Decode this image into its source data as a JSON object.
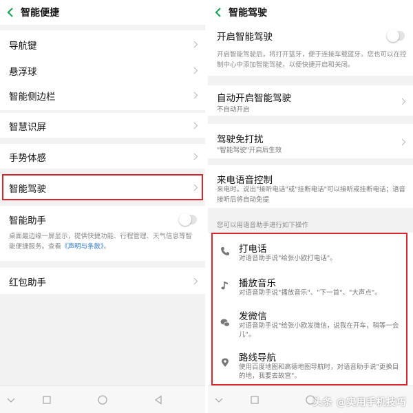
{
  "left": {
    "title": "智能便捷",
    "items": [
      {
        "label": "导航键"
      },
      {
        "label": "悬浮球"
      },
      {
        "label": "智能侧边栏"
      },
      {
        "label": "智慧识屏"
      },
      {
        "label": "手势体感"
      },
      {
        "label": "智能驾驶"
      },
      {
        "label": "智能助手"
      },
      {
        "label": "红包助手"
      }
    ],
    "assistant_desc_line1": "桌面最边缘一屏显示，提供快捷功能、行程管理、天气信息等智",
    "assistant_desc_line2_prefix": "能便捷服务。查看",
    "assistant_desc_link": "《声明与条款》",
    "assistant_desc_line2_suffix": "。"
  },
  "right": {
    "title": "智能驾驶",
    "enable_label": "开启智能驾驶",
    "enable_desc": "开启智能驾驶后，将打开蓝牙，便于连接车载蓝牙。您也可以在控制中心中添加智能驾驶，以便快捷开启和关闭。",
    "auto_label": "自动开启智能驾驶",
    "auto_sub": "不自动开启",
    "dnd_label": "驾驶免打扰",
    "dnd_sub": "\"智能驾驶\"开启后生效",
    "voice_label": "来电语音控制",
    "voice_desc": "来电时，说出\"接听电话\"或\"挂断电话\"可以接听或挂断电话；语音接听后将自动免提",
    "section_hint": "您可以用语音助手进行如下操作",
    "features": [
      {
        "icon": "phone-icon",
        "title": "打电话",
        "desc": "对语音助手说\"给张小欧打电话\"。"
      },
      {
        "icon": "music-note-icon",
        "title": "播放音乐",
        "desc": "对语音助手说\"播放音乐\"、\"下一首\"、\"大声点\"。"
      },
      {
        "icon": "wechat-icon",
        "title": "发微信",
        "desc": "对语音助手说\"给张小欧发微信，说我在开车，稍等一会儿\"。"
      },
      {
        "icon": "location-pin-icon",
        "title": "路线导航",
        "desc": "使用百度地图和高德地图导航时，对语音助手说\"更换目的地，我要去故宫\"。"
      }
    ]
  },
  "watermark": "头条 @实用手机技巧",
  "colors": {
    "highlight": "#d8262d",
    "accent": "#1aa55a",
    "link": "#2e7bd6"
  }
}
